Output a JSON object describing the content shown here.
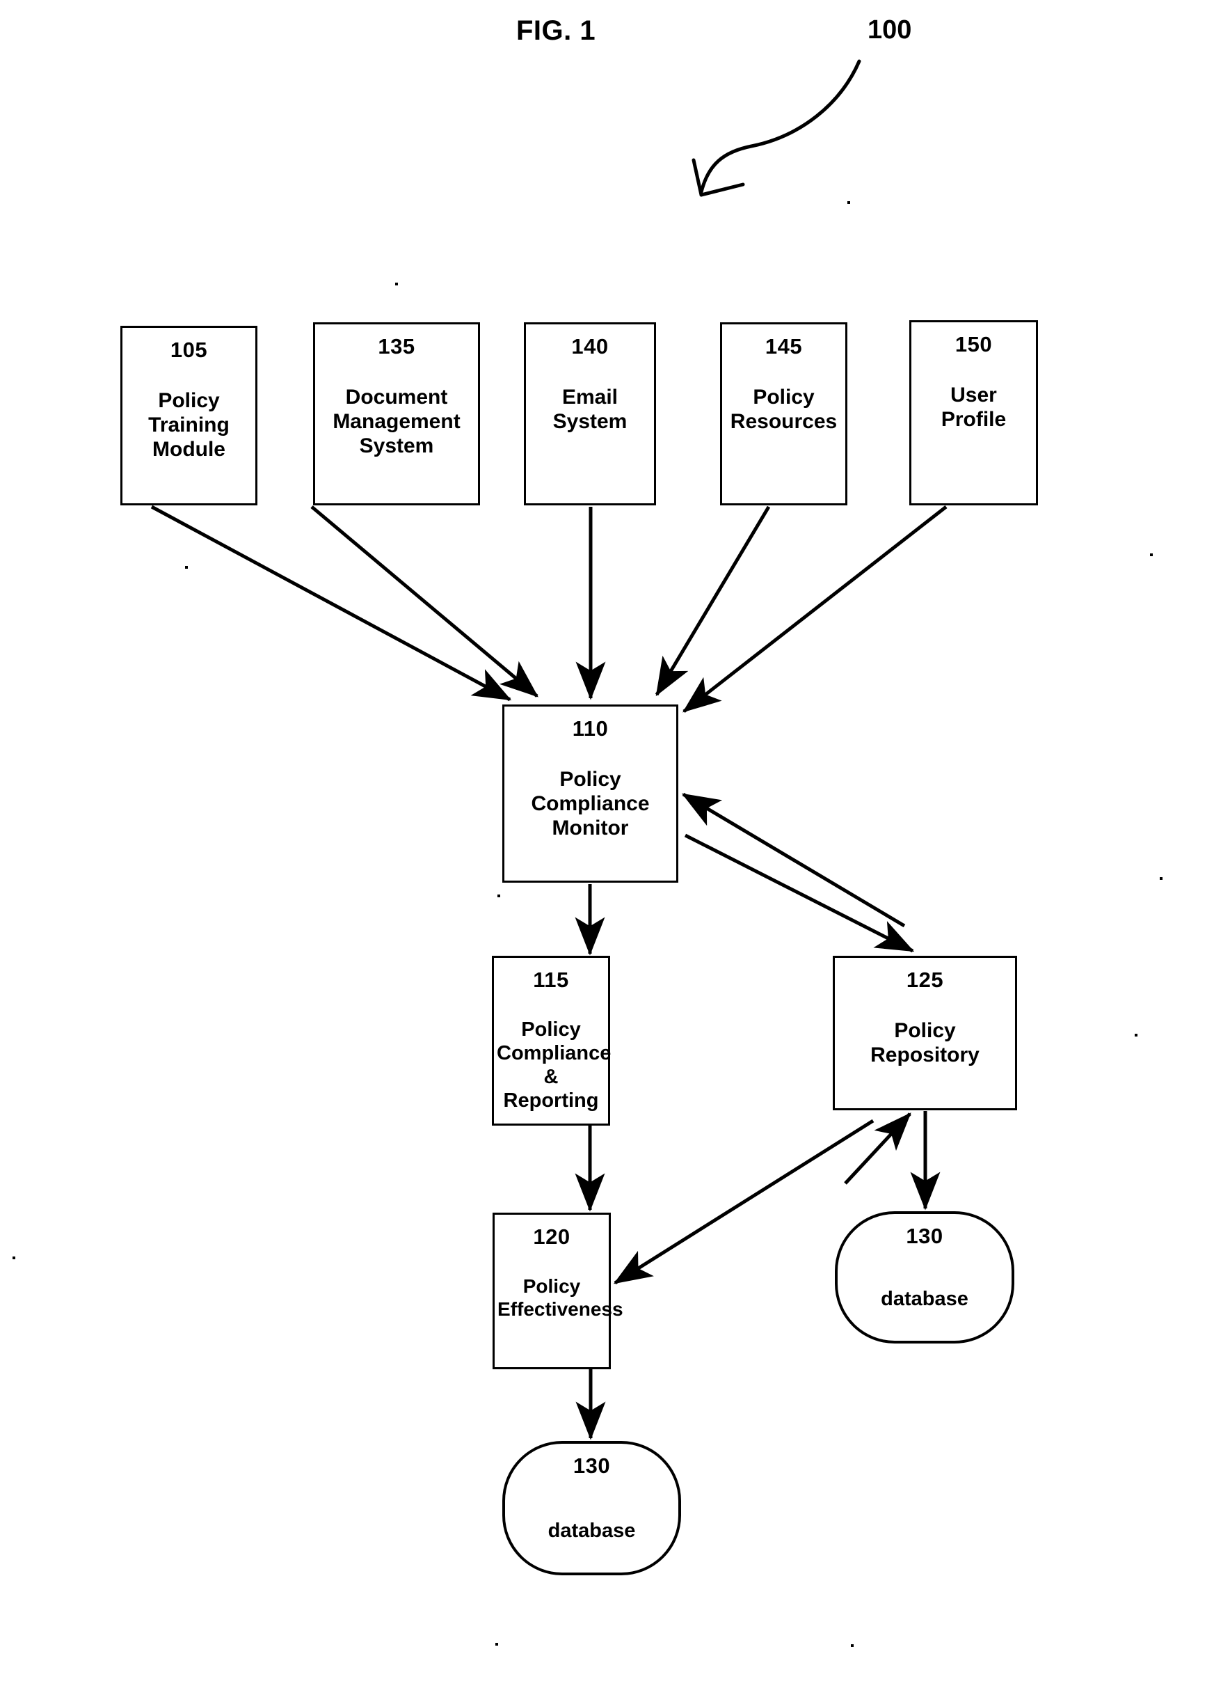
{
  "figure": {
    "title": "FIG. 1",
    "system_ref": "100"
  },
  "nodes": [
    {
      "id": "n105",
      "ref": "105",
      "label": "Policy\nTraining\nModule"
    },
    {
      "id": "n135",
      "ref": "135",
      "label": "Document\nManagement\nSystem"
    },
    {
      "id": "n140",
      "ref": "140",
      "label": "Email\nSystem"
    },
    {
      "id": "n145",
      "ref": "145",
      "label": "Policy\nResources"
    },
    {
      "id": "n150",
      "ref": "150",
      "label": "User\nProfile"
    },
    {
      "id": "n110",
      "ref": "110",
      "label": "Policy\nCompliance\nMonitor"
    },
    {
      "id": "n115",
      "ref": "115",
      "label": "Policy\nCompliance &\nReporting"
    },
    {
      "id": "n125",
      "ref": "125",
      "label": "Policy\nRepository"
    },
    {
      "id": "n120",
      "ref": "120",
      "label": "Policy\nEffectiveness"
    },
    {
      "id": "n130a",
      "ref": "130",
      "label": "database"
    },
    {
      "id": "n130b",
      "ref": "130",
      "label": "database"
    }
  ],
  "edges": [
    {
      "from": "n105",
      "to": "n110",
      "kind": "arrow"
    },
    {
      "from": "n135",
      "to": "n110",
      "kind": "arrow"
    },
    {
      "from": "n140",
      "to": "n110",
      "kind": "arrow"
    },
    {
      "from": "n145",
      "to": "n110",
      "kind": "arrow"
    },
    {
      "from": "n150",
      "to": "n110",
      "kind": "arrow"
    },
    {
      "from": "n110",
      "to": "n115",
      "kind": "arrow"
    },
    {
      "from": "n110",
      "to": "n125",
      "kind": "arrow"
    },
    {
      "from": "n125",
      "to": "n110",
      "kind": "arrow"
    },
    {
      "from": "n115",
      "to": "n120",
      "kind": "arrow"
    },
    {
      "from": "n125",
      "to": "n120",
      "kind": "arrow"
    },
    {
      "from": "n120",
      "to": "n125",
      "kind": "arrow"
    },
    {
      "from": "n125",
      "to": "n130a",
      "kind": "arrow"
    },
    {
      "from": "n120",
      "to": "n130b",
      "kind": "arrow"
    }
  ],
  "colors": {
    "ink": "#000000",
    "paper": "#ffffff"
  }
}
